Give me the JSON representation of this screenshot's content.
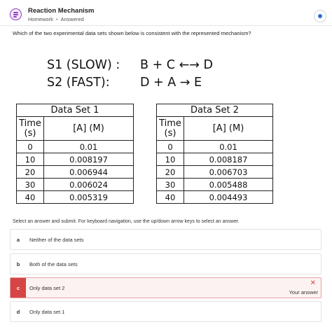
{
  "header": {
    "title": "Reaction Mechanism",
    "subtitle_type": "Homework",
    "subtitle_dot": "•",
    "subtitle_status": "Answered",
    "icon": "notes-icon",
    "accent_color": "#8e3fbf"
  },
  "question": "Which of the two experimental data sets shown below is consistent with the represented mechanism?",
  "mechanism": {
    "step1_label": "S1 (SLOW) :",
    "step1_eq": "B + C ←→ D",
    "step2_label": "S2 (FAST):",
    "step2_eq": "D + A → E"
  },
  "data_sets": [
    {
      "title": "Data Set 1",
      "time_header": "Time (s)",
      "conc_header": "[A] (M)",
      "rows": [
        {
          "t": "0",
          "a": "0.01"
        },
        {
          "t": "10",
          "a": "0.008197"
        },
        {
          "t": "20",
          "a": "0.006944"
        },
        {
          "t": "30",
          "a": "0.006024"
        },
        {
          "t": "40",
          "a": "0.005319"
        }
      ]
    },
    {
      "title": "Data Set 2",
      "time_header": "Time (s)",
      "conc_header": "[A] (M)",
      "rows": [
        {
          "t": "0",
          "a": "0.01"
        },
        {
          "t": "10",
          "a": "0.008187"
        },
        {
          "t": "20",
          "a": "0.006703"
        },
        {
          "t": "30",
          "a": "0.005488"
        },
        {
          "t": "40",
          "a": "0.004493"
        }
      ]
    }
  ],
  "instructions": "Select an answer and submit. For keyboard navigation, use the up/down arrow keys to select an answer.",
  "options": [
    {
      "letter": "a",
      "text": "Neither of the data sets"
    },
    {
      "letter": "b",
      "text": "Both of the data sets"
    },
    {
      "letter": "c",
      "text": "Only data set 2",
      "selected": true,
      "mark": "✕",
      "tag": "Your answer"
    },
    {
      "letter": "d",
      "text": "Only data set 1"
    }
  ],
  "colors": {
    "selected_border": "#e8a3a3",
    "selected_bg": "#fdf2f2",
    "wrong": "#d64545"
  }
}
